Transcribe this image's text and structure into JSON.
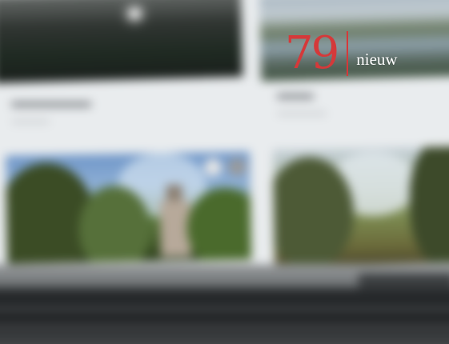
{
  "overlay": {
    "count": "79",
    "label": "nieuw",
    "accent_color": "#d5393a",
    "label_color": "#ffffff"
  },
  "photo": {
    "thumbnails": [
      {
        "name": "dark-lake-photo"
      },
      {
        "name": "lake-photo"
      },
      {
        "name": "castle-trees-photo"
      },
      {
        "name": "park-trees-photo"
      }
    ]
  }
}
